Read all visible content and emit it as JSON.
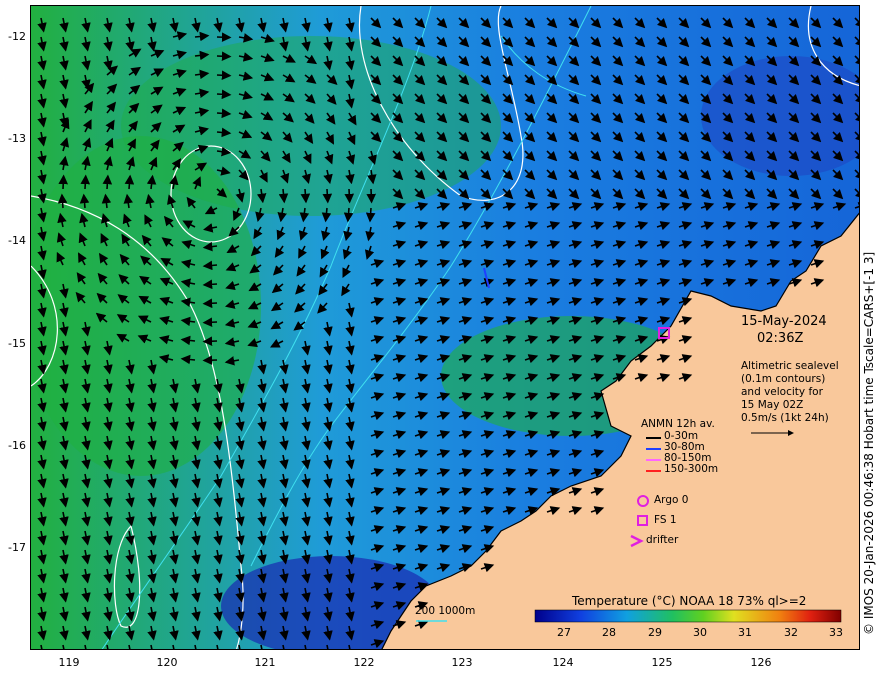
{
  "map": {
    "latitude_ticks": [
      "-12",
      "-13",
      "-14",
      "-15",
      "-16",
      "-17"
    ],
    "longitude_ticks": [
      "119",
      "120",
      "121",
      "122",
      "123",
      "124",
      "125",
      "126"
    ],
    "colors": {
      "land": "#f9c89b",
      "coast": "#000000",
      "contour": "#ffffff",
      "isobath": "#40e0f0",
      "arrow": "#000000"
    }
  },
  "info": {
    "date": "15-May-2024",
    "time": "02:36Z",
    "description": [
      "Altimetric sealevel",
      "(0.1m contours)",
      "and velocity for",
      "15 May 02Z",
      "0.5m/s (1kt 24h)"
    ]
  },
  "legend": {
    "title": "ANMN 12h av.",
    "items": [
      {
        "label": "0-30m",
        "color": "#000000"
      },
      {
        "label": "30-80m",
        "color": "#1f3fff"
      },
      {
        "label": "80-150m",
        "color": "#ff66ff"
      },
      {
        "label": "150-300m",
        "color": "#ff2020"
      }
    ],
    "argo": "Argo 0",
    "fs": "FS 1",
    "drifter": "drifter",
    "marker_color": "#e020e0"
  },
  "isobath_label": "200  1000m",
  "colorbar": {
    "title": "Temperature (°C) NOAA 18 73% ql>=2",
    "ticks": [
      "27",
      "28",
      "29",
      "30",
      "31",
      "32",
      "33"
    ]
  },
  "credit": "© IMOS 20-Jan-2026 00:46:38 Hobart time Tscale=CARS+[-1 3]"
}
